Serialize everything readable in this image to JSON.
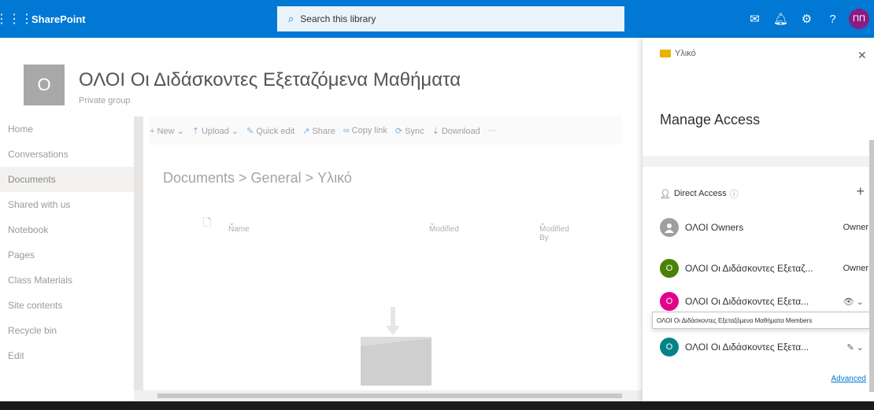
{
  "suitebar": {
    "app_name": "SharePoint",
    "search_placeholder": "Search this library",
    "avatar_initials": "ΠΠ",
    "accent": "#0078d4"
  },
  "site": {
    "logo_letter": "Ο",
    "title": "ΟΛΟΙ Οι Διδάσκοντες Εξεταζόμενα Μαθήματα",
    "subtitle": "Private group"
  },
  "leftnav": {
    "items": [
      {
        "label": "Home"
      },
      {
        "label": "Conversations"
      },
      {
        "label": "Documents"
      },
      {
        "label": "Shared with us"
      },
      {
        "label": "Notebook"
      },
      {
        "label": "Pages"
      },
      {
        "label": "Class Materials"
      },
      {
        "label": "Site contents"
      },
      {
        "label": "Recycle bin"
      },
      {
        "label": "Edit"
      }
    ],
    "active_index": 2
  },
  "commandbar": {
    "new": "New",
    "upload": "Upload",
    "quick_edit": "Quick edit",
    "share": "Share",
    "copy_link": "Copy link",
    "sync": "Sync",
    "download": "Download",
    "more": "···"
  },
  "breadcrumb": {
    "text": "Documents > General > Υλικό"
  },
  "columns": {
    "name": "Name",
    "modified": "Modified",
    "modified_by": "Modified By"
  },
  "panel": {
    "folder_name": "Υλικό",
    "title": "Manage Access",
    "direct_access": "Direct Access",
    "entries": [
      {
        "name": "ΟΛΟΙ Owners",
        "role": "Owner",
        "avatar": "",
        "color": "#a19f9d"
      },
      {
        "name": "ΟΛΟΙ Οι Διδάσκοντες Εξεταζ...",
        "role": "Owner",
        "avatar": "Ο",
        "color": "#498205"
      },
      {
        "name": "ΟΛΟΙ Οι Διδάσκοντες Εξετα...",
        "role": "",
        "avatar": "Ο",
        "color": "#e3008c"
      },
      {
        "name": "ΟΛΟΙ Οι Διδάσκοντες Εξετα...",
        "role": "",
        "avatar": "Ο",
        "color": "#038387"
      }
    ],
    "tooltip": "ΟΛΟΙ Οι Διδάσκοντες Εξεταζόμενα Μαθήματα Members",
    "advanced": "Advanced"
  }
}
